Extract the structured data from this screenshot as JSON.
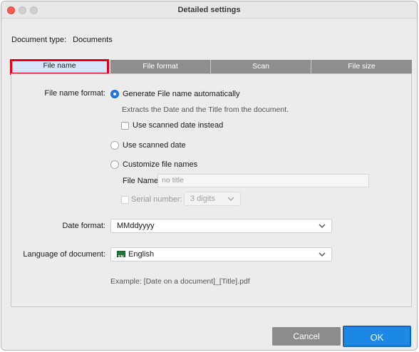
{
  "window": {
    "title": "Detailed settings"
  },
  "document_type": {
    "label": "Document type:",
    "value": "Documents"
  },
  "tabs": [
    {
      "label": "File name",
      "active": true
    },
    {
      "label": "File format",
      "active": false
    },
    {
      "label": "Scan",
      "active": false
    },
    {
      "label": "File size",
      "active": false
    }
  ],
  "file_name_format": {
    "label": "File name format:",
    "option_auto": "Generate File name automatically",
    "auto_description": "Extracts the Date and the Title from the document.",
    "use_scanned_date_instead": "Use scanned date instead",
    "option_scanned_date": "Use scanned date",
    "option_customize": "Customize file names",
    "selected": "Generate File name automatically",
    "file_name_label": "File Name:",
    "file_name_placeholder": "no title",
    "serial_number_label": "Serial number:",
    "serial_number_value": "3 digits"
  },
  "date_format": {
    "label": "Date format:",
    "value": "MMddyyyy"
  },
  "language": {
    "label": "Language of document:",
    "value": "English"
  },
  "example": "Example: [Date on a document]_[Title].pdf",
  "buttons": {
    "cancel": "Cancel",
    "ok": "OK"
  },
  "colors": {
    "accent": "#1e88e5",
    "highlight_border": "#e3001b",
    "tab_inactive": "#8e8e8e"
  }
}
